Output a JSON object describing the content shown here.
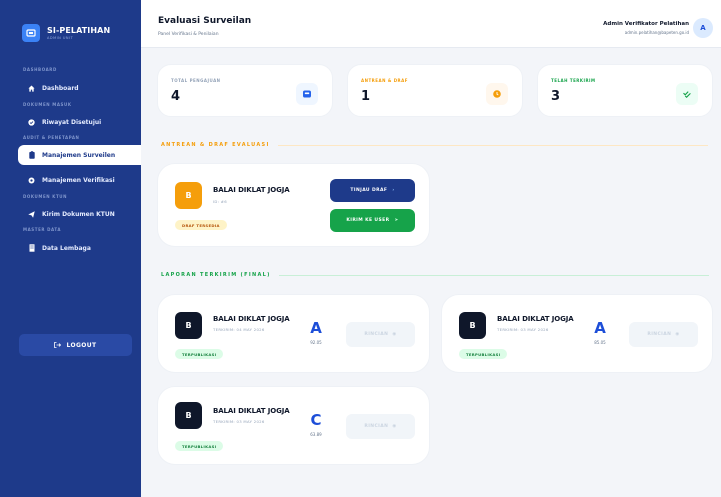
{
  "sidebar": {
    "brand_title": "SI-PELATIHAN",
    "brand_sub": "ADMIN UNIT",
    "sections": {
      "dashboard": "DASHBOARD",
      "dokumen_masuk": "DOKUMEN MASUK",
      "audit": "AUDIT & PENETAPAN",
      "dokumen_ktun": "DOKUMEN KTUN",
      "master": "MASTER DATA"
    },
    "items": {
      "dashboard": "Dashboard",
      "riwayat": "Riwayat Disetujui",
      "surveilan": "Manajemen Surveilen",
      "verifikasi": "Manajemen Verifikasi",
      "ktun": "Kirim Dokumen KTUN",
      "lembaga": "Data Lembaga"
    },
    "logout": "LOGOUT"
  },
  "header": {
    "title": "Evaluasi Surveilan",
    "subtitle": "Panel Verifikasi & Penilaian",
    "admin_name": "Admin Verifikator Pelatihan",
    "admin_email": "admin.pelatihan@bapeten.go.id",
    "avatar_letter": "A"
  },
  "stats": [
    {
      "label": "TOTAL PENGAJUAN",
      "value": "4",
      "color": "#2563eb"
    },
    {
      "label": "ANTREAN & DRAF",
      "value": "1",
      "color": "#f59e0b"
    },
    {
      "label": "TELAH TERKIRIM",
      "value": "3",
      "color": "#16a34a"
    }
  ],
  "sections": {
    "antrean": "ANTREAN & DRAF EVALUASI",
    "laporan": "LAPORAN TERKIRIM (FINAL)"
  },
  "draft": {
    "logo_letter": "B",
    "name": "BALAI DIKLAT JOGJA",
    "meta": "ID: #6",
    "badge": "DRAF TERSEDIA",
    "btn_review": "TINJAU DRAF",
    "btn_send": "KIRIM KE USER"
  },
  "reports": [
    {
      "logo_letter": "B",
      "name": "BALAI DIKLAT JOGJA",
      "meta": "TERKIRIM: 04 MAY 2026",
      "badge": "TERPUBLIKASI",
      "grade": "A",
      "score": "92.05",
      "action": "RINCIAN"
    },
    {
      "logo_letter": "B",
      "name": "BALAI DIKLAT JOGJA",
      "meta": "TERKIRIM: 03 MAY 2026",
      "badge": "TERPUBLIKASI",
      "grade": "A",
      "score": "85.05",
      "action": "RINCIAN"
    },
    {
      "logo_letter": "B",
      "name": "BALAI DIKLAT JOGJA",
      "meta": "TERKIRIM: 03 MAY 2026",
      "badge": "TERPUBLIKASI",
      "grade": "C",
      "score": "63.89",
      "action": "RINCIAN"
    }
  ]
}
